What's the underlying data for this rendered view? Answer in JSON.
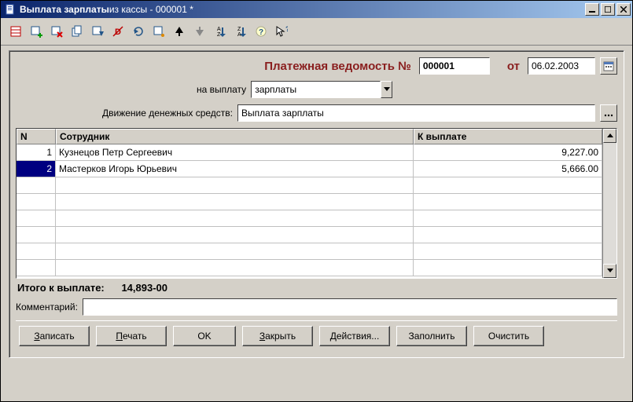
{
  "title": {
    "bold": "Выплата зарплаты",
    "rest": " из кассы - 000001 *"
  },
  "toolbar_icons": [
    "grid-red-icon",
    "grid-add-icon",
    "grid-delete-icon",
    "grid-copy-icon",
    "grid-move-icon",
    "mark-delete-icon",
    "refresh-icon",
    "edit-row-icon",
    "arrow-up-icon",
    "arrow-down-icon",
    "sort-asc-icon",
    "sort-desc-icon",
    "help-icon",
    "context-help-icon"
  ],
  "header": {
    "title": "Платежная ведомость №",
    "doc_number": "000001",
    "from_label": "от",
    "doc_date": "06.02.2003"
  },
  "row_payment": {
    "label": "на выплату",
    "value": "зарплаты"
  },
  "row_movement": {
    "label": "Движение денежных средств:",
    "value": "Выплата зарплаты"
  },
  "grid": {
    "col_n": "N",
    "col_emp": "Сотрудник",
    "col_amt": "К выплате",
    "rows": [
      {
        "n": "1",
        "emp": "Кузнецов Петр Сергеевич",
        "amt": "9,227.00"
      },
      {
        "n": "2",
        "emp": "Мастерков Игорь Юрьевич",
        "amt": "5,666.00"
      }
    ],
    "selected_index": 1
  },
  "total": {
    "label": "Итого к выплате:",
    "value": "14,893-00"
  },
  "comment_label": "Комментарий:",
  "comment_value": "",
  "buttons": {
    "save": "Записать",
    "print": "Печать",
    "ok": "OK",
    "close": "Закрыть",
    "actions": "Действия...",
    "fill": "Заполнить",
    "clear": "Очистить"
  }
}
